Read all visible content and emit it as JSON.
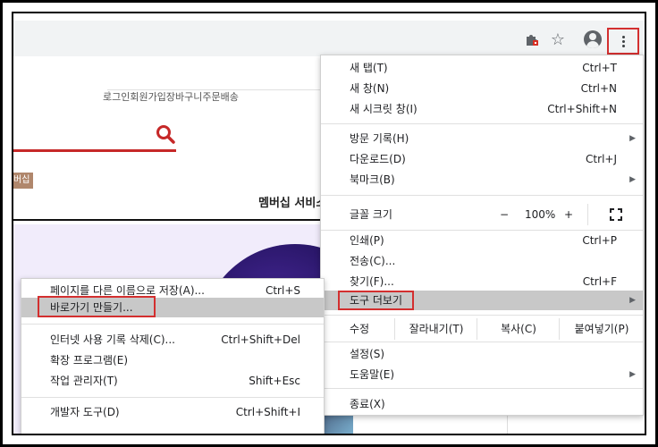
{
  "topnav": {
    "items": [
      "로그인",
      "회원가입",
      "장바구니",
      "주문배송"
    ]
  },
  "member_badge": "버십",
  "member_title": "멤버십 서비스",
  "menu": {
    "new_tab": {
      "label": "새 탭(T)",
      "shortcut": "Ctrl+T"
    },
    "new_window": {
      "label": "새 창(N)",
      "shortcut": "Ctrl+N"
    },
    "incognito": {
      "label": "새 시크릿 창(I)",
      "shortcut": "Ctrl+Shift+N"
    },
    "history": {
      "label": "방문 기록(H)"
    },
    "downloads": {
      "label": "다운로드(D)",
      "shortcut": "Ctrl+J"
    },
    "bookmarks": {
      "label": "북마크(B)"
    },
    "zoom": {
      "label": "글꼴 크기",
      "minus": "−",
      "value": "100%",
      "plus": "+"
    },
    "print": {
      "label": "인쇄(P)",
      "shortcut": "Ctrl+P"
    },
    "cast": {
      "label": "전송(C)..."
    },
    "find": {
      "label": "찾기(F)...",
      "shortcut": "Ctrl+F"
    },
    "more_tools": {
      "label": "도구 더보기"
    },
    "edit": {
      "label": "수정",
      "cut": "잘라내기(T)",
      "copy": "복사(C)",
      "paste": "붙여넣기(P)"
    },
    "settings": {
      "label": "설정(S)"
    },
    "help": {
      "label": "도움말(E)"
    },
    "exit": {
      "label": "종료(X)"
    }
  },
  "submenu": {
    "save_page": {
      "label": "페이지를 다른 이름으로 저장(A)...",
      "shortcut": "Ctrl+S"
    },
    "create_shortcut": {
      "label": "바로가기 만들기..."
    },
    "clear_data": {
      "label": "인터넷 사용 기록 삭제(C)...",
      "shortcut": "Ctrl+Shift+Del"
    },
    "extensions": {
      "label": "확장 프로그램(E)"
    },
    "task_manager": {
      "label": "작업 관리자(T)",
      "shortcut": "Shift+Esc"
    },
    "dev_tools": {
      "label": "개발자 도구(D)",
      "shortcut": "Ctrl+Shift+I"
    }
  },
  "colors": {
    "highlight_box": "#d32f2f",
    "hover_bg": "#c8c8c8",
    "accent_red": "#c62828"
  },
  "icons": {
    "extension": "puzzle-icon",
    "bookmark": "star-icon",
    "profile": "account-icon",
    "menu": "kebab-menu-icon",
    "search": "search-icon",
    "fullscreen": "fullscreen-icon",
    "arrow": "submenu-arrow-icon"
  }
}
